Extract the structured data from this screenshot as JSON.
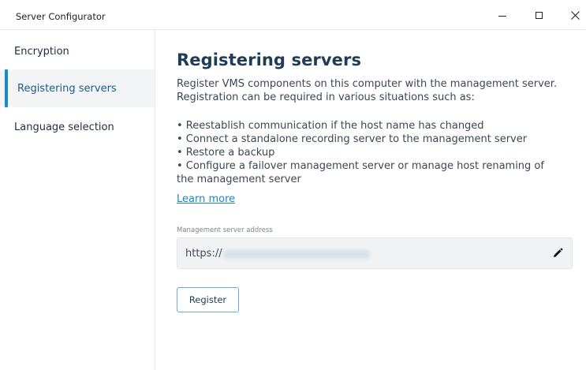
{
  "window": {
    "title": "Server Configurator",
    "controls": {
      "minimize": "minimize",
      "maximize": "maximize",
      "close": "close"
    }
  },
  "sidebar": {
    "items": [
      {
        "label": "Encryption",
        "active": false
      },
      {
        "label": "Registering servers",
        "active": true
      },
      {
        "label": "Language selection",
        "active": false
      }
    ]
  },
  "main": {
    "title": "Registering servers",
    "intro": "Register VMS components on this computer with the management server. Registration can be required in various situations such as:",
    "bullets": [
      "• Reestablish communication if the host name has changed",
      "• Connect a standalone recording server to the management server",
      "• Restore a backup",
      "• Configure a failover management server or manage host renaming of the management server"
    ],
    "learn_more": "Learn more",
    "address": {
      "label": "Management server address",
      "value_prefix": "https://"
    },
    "register_button": "Register"
  },
  "colors": {
    "accent": "#1a87c8",
    "title": "#1e3c55",
    "active_bg": "#f2f4f6",
    "field_bg": "#f0f2f4"
  },
  "icons": {
    "edit": "pencil-icon"
  }
}
